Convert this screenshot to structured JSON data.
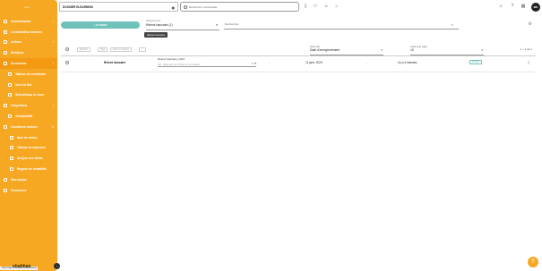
{
  "sidebar": {
    "logo_text": "emc",
    "items": [
      {
        "label": "Administration",
        "chevron": "›",
        "level": 0
      },
      {
        "label": "Centralisation dossiers",
        "chevron": "",
        "level": 0
      },
      {
        "label": "Actions",
        "chevron": "›",
        "level": 0
      },
      {
        "label": "Relations",
        "chevron": "",
        "level": 0
      },
      {
        "label": "Documents",
        "chevron": "›",
        "level": 0,
        "active": true
      },
      {
        "label": "Tableau de commande",
        "chevron": "",
        "level": 1
      },
      {
        "label": "Suivi de BIA",
        "chevron": "",
        "level": 1
      },
      {
        "label": "Bibliothèque de docs",
        "chevron": "",
        "level": 1
      },
      {
        "label": "Intégrations",
        "chevron": "›",
        "level": 0
      },
      {
        "label": "Comptabilité",
        "chevron": "",
        "level": 1
      },
      {
        "label": "Conditions remises",
        "chevron": "˄",
        "level": 0
      },
      {
        "label": "Note de remise",
        "chevron": "",
        "level": 2
      },
      {
        "label": "Tableau de dépenses",
        "chevron": "",
        "level": 2
      },
      {
        "label": "Analyse des délais",
        "chevron": "",
        "level": 2
      },
      {
        "label": "Rapport de rentabilité",
        "chevron": "",
        "level": 2
      },
      {
        "label": "Mon équipe",
        "chevron": "",
        "level": 0
      },
      {
        "label": "Paramètres",
        "chevron": "",
        "level": 0
      }
    ],
    "footer_logo": "ebabbee",
    "collapse_glyph": "‹",
    "status_url": "https://app.example.io/dashboard"
  },
  "topbar": {
    "dossier_value": "DOSSIER ELEARNINO",
    "search_placeholder": "Recherche contextuelle",
    "avatar_initials": "MD",
    "icons": [
      "document-icon",
      "users-icon",
      "user-icon",
      "tag-icon",
      "bell-icon",
      "question-icon",
      "grid-icon"
    ]
  },
  "filters": {
    "filter_button": "+ FILTRER",
    "select_label": "Pertinent pour",
    "select_value": "Relevé bancaire (1)",
    "search_placeholder": "Rechercher",
    "tooltip": "Relevé bancaire"
  },
  "table": {
    "header_chips": [
      "Exporter",
      "Tags",
      "Créer un dossier",
      "..."
    ],
    "col_filter_label": "Filtrer par",
    "col_filter_value": "Date d'enregistrement",
    "col_rows_label": "Lignes par page",
    "col_rows_value": "10",
    "pagination": "1 – 1 de 1",
    "rows": [
      {
        "name": "Relevé bancaire",
        "doc_title": "Relevé bancaire_2023",
        "doc_placeholder": "Déposer un fichier ici ou cliquer",
        "dash1": "-",
        "date": "11 janv. 2023",
        "dash2": "-",
        "duration": "il y a 4 minutes",
        "tag": "Ouvert"
      }
    ]
  },
  "help_glyph": "?"
}
